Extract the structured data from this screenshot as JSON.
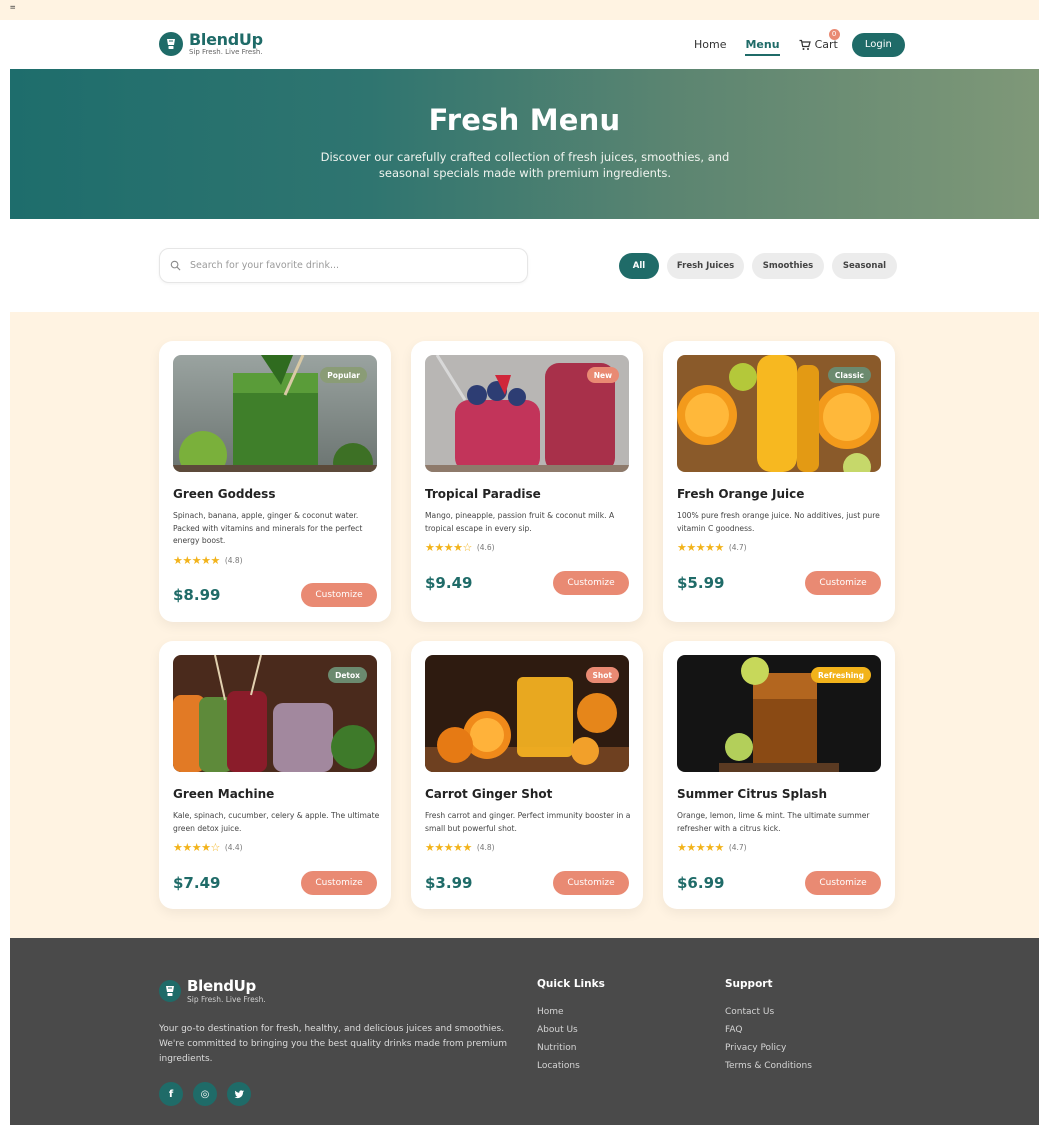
{
  "brand": {
    "name": "BlendUp",
    "tagline": "Sip Fresh. Live Fresh."
  },
  "nav": {
    "links": [
      {
        "label": "Home"
      },
      {
        "label": "Menu",
        "active": true
      }
    ],
    "cart_label": "Cart",
    "cart_count": "0",
    "login_label": "Login"
  },
  "hero": {
    "title": "Fresh Menu",
    "subtitle": "Discover our carefully crafted collection of fresh juices, smoothies, and seasonal specials made with premium ingredients."
  },
  "search": {
    "placeholder": "Search for your favorite drink..."
  },
  "filters": [
    {
      "label": "All",
      "active": true
    },
    {
      "label": "Fresh Juices"
    },
    {
      "label": "Smoothies"
    },
    {
      "label": "Seasonal"
    }
  ],
  "products": [
    {
      "name": "Green Goddess",
      "badge": "Popular",
      "badge_color": "#8a9c76",
      "description": "Spinach, banana, apple, ginger & coconut water. Packed with vitamins and minerals for the perfect energy boost.",
      "stars": "★★★★★",
      "rating": "(4.8)",
      "rating_value": 4.8,
      "price": "$8.99",
      "button": "Customize"
    },
    {
      "name": "Tropical Paradise",
      "badge": "New",
      "badge_color": "#e98a73",
      "description": "Mango, pineapple, passion fruit & coconut milk. A tropical escape in every sip.",
      "stars": "★★★★☆",
      "rating": "(4.6)",
      "rating_value": 4.6,
      "price": "$9.49",
      "button": "Customize"
    },
    {
      "name": "Fresh Orange Juice",
      "badge": "Classic",
      "badge_color": "#6b8a6f",
      "description": "100% pure fresh orange juice. No additives, just pure vitamin C goodness.",
      "stars": "★★★★★",
      "rating": "(4.7)",
      "rating_value": 4.7,
      "price": "$5.99",
      "button": "Customize"
    },
    {
      "name": "Green Machine",
      "badge": "Detox",
      "badge_color": "#6b8a6f",
      "description": "Kale, spinach, cucumber, celery & apple. The ultimate green detox juice.",
      "stars": "★★★★☆",
      "rating": "(4.4)",
      "rating_value": 4.4,
      "price": "$7.49",
      "button": "Customize"
    },
    {
      "name": "Carrot Ginger Shot",
      "badge": "Shot",
      "badge_color": "#e98a73",
      "description": "Fresh carrot and ginger. Perfect immunity booster in a small but powerful shot.",
      "stars": "★★★★★",
      "rating": "(4.8)",
      "rating_value": 4.8,
      "price": "$3.99",
      "button": "Customize"
    },
    {
      "name": "Summer Citrus Splash",
      "badge": "Refreshing",
      "badge_color": "#f2b31b",
      "description": "Orange, lemon, lime & mint. The ultimate summer refresher with a citrus kick.",
      "stars": "★★★★★",
      "rating": "(4.7)",
      "rating_value": 4.7,
      "price": "$6.99",
      "button": "Customize"
    }
  ],
  "footer": {
    "about": "Your go-to destination for fresh, healthy, and delicious juices and smoothies. We're committed to bringing you the best quality drinks made from premium ingredients.",
    "socials": [
      {
        "icon": "facebook-icon",
        "glyph": "f"
      },
      {
        "icon": "instagram-icon",
        "glyph": "◎"
      },
      {
        "icon": "twitter-icon",
        "glyph": "♥"
      }
    ],
    "quick_links": {
      "title": "Quick Links",
      "items": [
        "Home",
        "About Us",
        "Nutrition",
        "Locations"
      ]
    },
    "support": {
      "title": "Support",
      "items": [
        "Contact Us",
        "FAQ",
        "Privacy Policy",
        "Terms & Conditions"
      ]
    }
  },
  "colors": {
    "primary": "#1f6b68",
    "accent": "#e98a73",
    "cream": "#fff3e2",
    "star": "#f2b31b",
    "footer": "#4a4a4a"
  }
}
